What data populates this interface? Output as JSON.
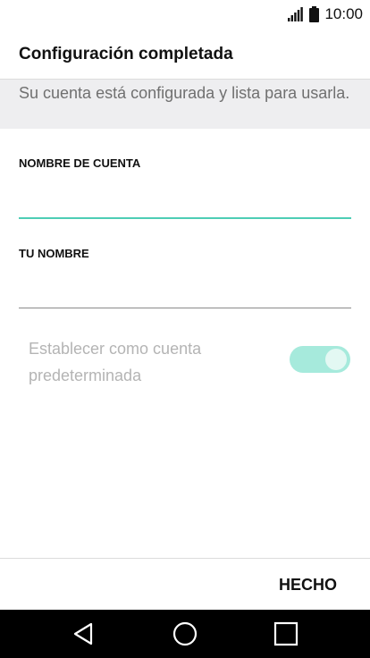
{
  "status_bar": {
    "time": "10:00",
    "icons": [
      "signal-icon",
      "battery-icon"
    ]
  },
  "header": {
    "title": "Configuración completada"
  },
  "info": {
    "text": "Su cuenta está configurada y lista para usarla."
  },
  "form": {
    "account_name": {
      "label": "NOMBRE DE CUENTA",
      "value": ""
    },
    "your_name": {
      "label": "TU NOMBRE",
      "value": ""
    },
    "default_account": {
      "label": "Establecer como cuenta predeterminada",
      "enabled": false,
      "checked": true
    }
  },
  "actions": {
    "done_label": "HECHO"
  },
  "nav_bar": {
    "icons": [
      "back-icon",
      "home-icon",
      "recents-icon"
    ]
  },
  "colors": {
    "accent": "#4ecdb5",
    "toggle_track": "#a6eadc",
    "info_bg": "#eeeef0",
    "nav_bg": "#000000"
  }
}
